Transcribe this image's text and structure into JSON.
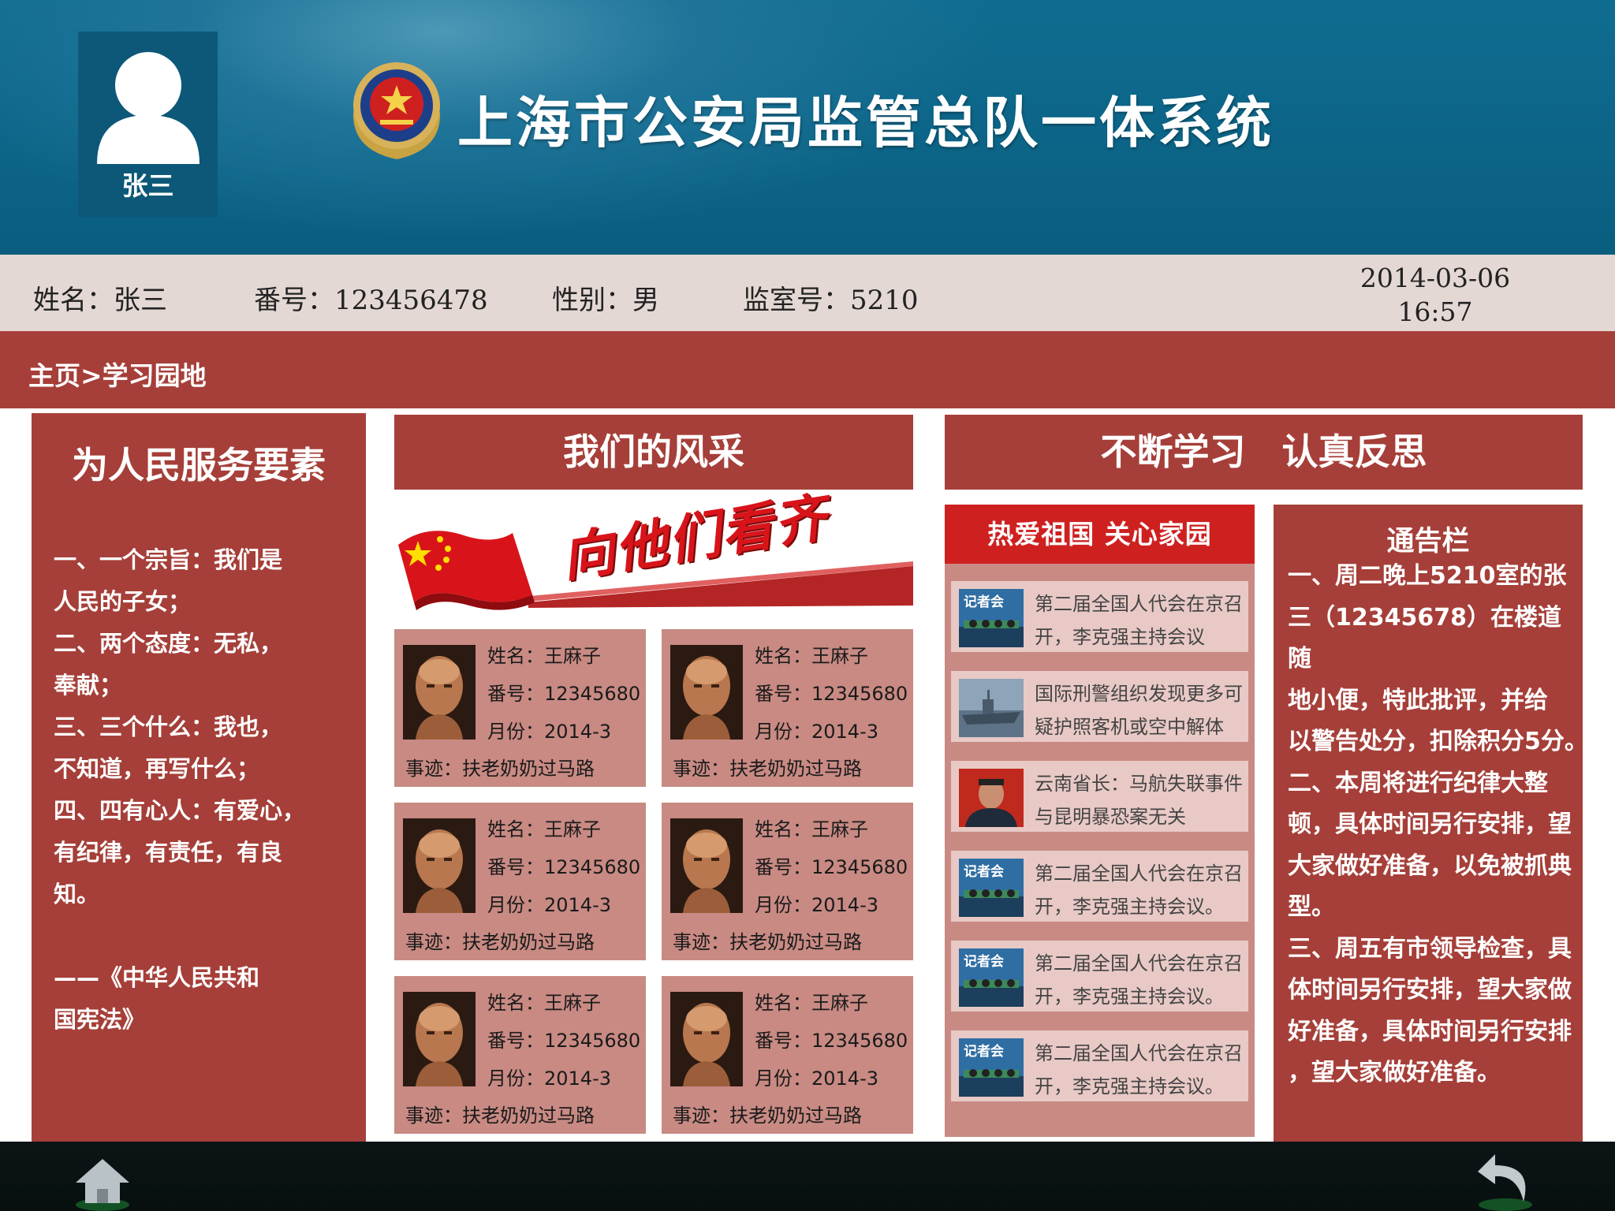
{
  "app": {
    "title": "上海市公安局监管总队一体系统"
  },
  "user": {
    "name": "张三"
  },
  "inmate": {
    "name_label": "姓名：张三",
    "number_label": "番号：123456478",
    "gender_label": "性别：男",
    "cell_label": "监室号：5210"
  },
  "datetime": {
    "date": "2014-03-06",
    "time": "16:57"
  },
  "breadcrumb": "主页>学习园地",
  "left_panel": {
    "title": "为人民服务要素",
    "lines": [
      "一、一个宗旨：我们是",
      "人民的子女；",
      "二、两个态度：无私，",
      "奉献；",
      "三、三个什么：我也，",
      "不知道，再写什么；",
      "四、四有心人：有爱心，",
      "有纪律，有责任，有良",
      "知。"
    ],
    "quote_lines": [
      "——《中华人民共和",
      "国宪法》"
    ]
  },
  "middle_panel": {
    "title": "我们的风采",
    "banner_text": "向他们看齐",
    "cards": [
      {
        "name": "姓名：王麻子",
        "number": "番号：12345680",
        "month": "月份：2014-3",
        "deed": "事迹：扶老奶奶过马路"
      },
      {
        "name": "姓名：王麻子",
        "number": "番号：12345680",
        "month": "月份：2014-3",
        "deed": "事迹：扶老奶奶过马路"
      },
      {
        "name": "姓名：王麻子",
        "number": "番号：12345680",
        "month": "月份：2014-3",
        "deed": "事迹：扶老奶奶过马路"
      },
      {
        "name": "姓名：王麻子",
        "number": "番号：12345680",
        "month": "月份：2014-3",
        "deed": "事迹：扶老奶奶过马路"
      },
      {
        "name": "姓名：王麻子",
        "number": "番号：12345680",
        "month": "月份：2014-3",
        "deed": "事迹：扶老奶奶过马路"
      },
      {
        "name": "姓名：王麻子",
        "number": "番号：12345680",
        "month": "月份：2014-3",
        "deed": "事迹：扶老奶奶过马路"
      }
    ]
  },
  "right_panel": {
    "title": "不断学习　认真反思",
    "news": {
      "title": "热爱祖国 关心家园",
      "thumb_text": "记者会",
      "items": [
        {
          "line1": "第二届全国人代会在京召",
          "line2": "开，李克强主持会议",
          "thumb": "press"
        },
        {
          "line1": "国际刑警组织发现更多可",
          "line2": "疑护照客机或空中解体",
          "thumb": "ship"
        },
        {
          "line1": "云南省长：马航失联事件",
          "line2": "与昆明暴恐案无关",
          "thumb": "portrait"
        },
        {
          "line1": "第二届全国人代会在京召",
          "line2": "开，李克强主持会议。",
          "thumb": "press"
        },
        {
          "line1": "第二届全国人代会在京召",
          "line2": "开，李克强主持会议。",
          "thumb": "press"
        },
        {
          "line1": "第二届全国人代会在京召",
          "line2": "开，李克强主持会议。",
          "thumb": "press"
        }
      ]
    },
    "notice": {
      "title": "通告栏",
      "lines": [
        "一、周二晚上5210室的张",
        "三（12345678）在楼道随",
        "地小便，特此批评，并给",
        "以警告处分，扣除积分5分。",
        "二、本周将进行纪律大整",
        "顿，具体时间另行安排，望",
        "大家做好准备，以免被抓典",
        "型。",
        "三、周五有市领导检查，具",
        "体时间另行安排，望大家做",
        "好准备，具体时间另行安排",
        "，望大家做好准备。"
      ]
    }
  },
  "nav": {
    "home_icon": "home-icon",
    "back_icon": "back-arrow-icon"
  },
  "colors": {
    "header": "#0f6d91",
    "accent": "#a63f39",
    "card": "#c88a83",
    "news_head": "#cf2020",
    "info_bar": "#e4d8d4"
  }
}
